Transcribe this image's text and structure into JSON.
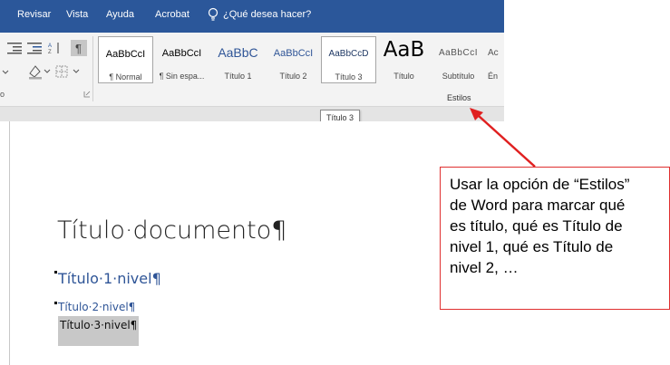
{
  "menubar": {
    "items": [
      "Revisar",
      "Vista",
      "Ayuda",
      "Acrobat"
    ],
    "tell_me": "¿Qué desea hacer?"
  },
  "ribbon": {
    "styles": [
      {
        "sample": "AaBbCcI",
        "name": "¶ Normal",
        "selected": true
      },
      {
        "sample": "AaBbCcI",
        "name": "¶ Sin espa..."
      },
      {
        "sample": "AaBbC",
        "name": "Título 1"
      },
      {
        "sample": "AaBbCcI",
        "name": "Título 2"
      },
      {
        "sample": "AaBbCcD",
        "name": "Título 3",
        "selected": true
      },
      {
        "sample": "AaB",
        "name": "Título"
      },
      {
        "sample": "AaBbCcI",
        "name": "Subtítulo"
      },
      {
        "sample": "Ac",
        "name": "Én"
      }
    ],
    "group_label": "Estilos",
    "tooltip": "Título 3"
  },
  "document": {
    "title": "Título·documento¶",
    "heading1": "Título·1·nivel¶",
    "heading2": "Título·2·nivel¶",
    "heading3": "Título·3·nivel¶"
  },
  "annotation": {
    "lines": [
      "Usar la opción de “Estilos”",
      "de Word para marcar qué",
      "es título, qué  es Título de",
      "nivel 1, qué es Título de",
      "nivel 2, …"
    ]
  },
  "colors": {
    "menubar": "#2b579a",
    "heading_blue": "#2f5597",
    "annotation_red": "#e03030"
  }
}
